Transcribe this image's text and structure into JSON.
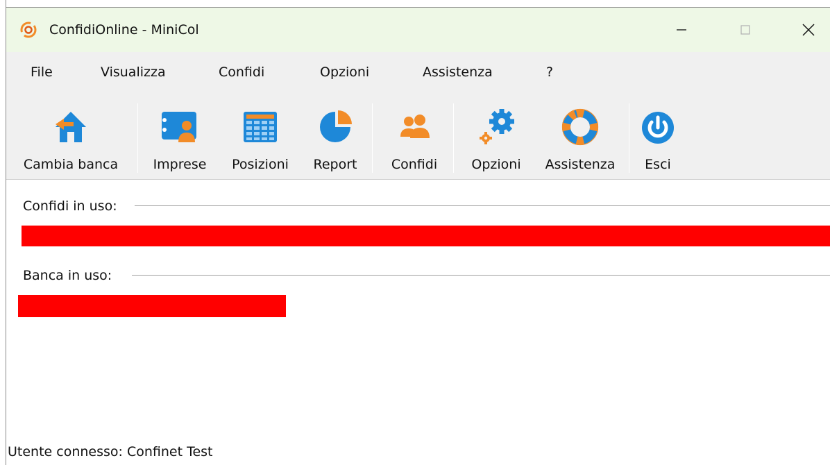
{
  "window": {
    "title": "ConfidiOnline - MiniCol",
    "controls": [
      "minimize",
      "maximize",
      "close"
    ]
  },
  "menu": {
    "items": [
      "File",
      "Visualizza",
      "Confidi",
      "Opzioni",
      "Assistenza",
      "?"
    ]
  },
  "toolbar": {
    "buttons": [
      {
        "label": "Cambia banca",
        "icon": "home-arrow-icon"
      },
      {
        "label": "Imprese",
        "icon": "business-card-icon"
      },
      {
        "label": "Posizioni",
        "icon": "spreadsheet-icon"
      },
      {
        "label": "Report",
        "icon": "pie-chart-icon"
      },
      {
        "label": "Confidi",
        "icon": "users-icon"
      },
      {
        "label": "Opzioni",
        "icon": "gears-icon"
      },
      {
        "label": "Assistenza",
        "icon": "lifebuoy-icon"
      },
      {
        "label": "Esci",
        "icon": "power-icon"
      }
    ]
  },
  "content": {
    "confidi_label": "Confidi in uso:",
    "banca_label": "Banca in uso:"
  },
  "status": {
    "text": "Utente connesso: Confinet Test"
  },
  "colors": {
    "titlebar_bg": "#eef8e6",
    "toolbar_bg": "#f0f0f0",
    "redaction": "#ff0000",
    "icon_blue": "#1e88d8",
    "icon_orange": "#f28c28"
  }
}
